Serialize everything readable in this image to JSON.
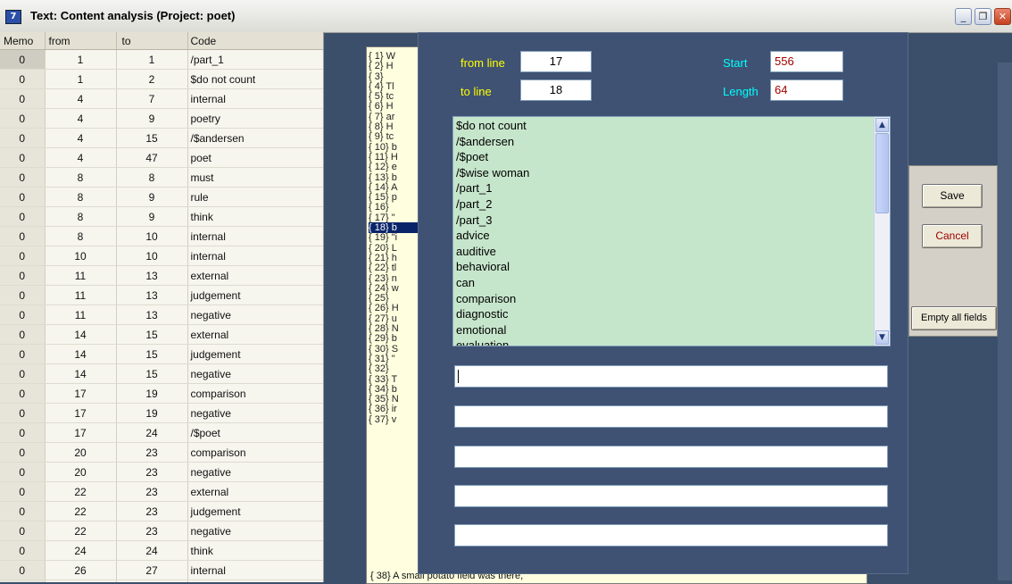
{
  "window": {
    "title": "Text: Content analysis (Project: poet)",
    "icon_label": "7",
    "controls": {
      "minimize": "_",
      "restore": "❐",
      "close": "✕"
    }
  },
  "grid": {
    "headers": {
      "memo": "Memo",
      "from": "from",
      "to": "to",
      "code": "Code"
    },
    "rows": [
      {
        "memo": "0",
        "from": "1",
        "to": "1",
        "code": "/part_1"
      },
      {
        "memo": "0",
        "from": "1",
        "to": "2",
        "code": "$do not count"
      },
      {
        "memo": "0",
        "from": "4",
        "to": "7",
        "code": "internal"
      },
      {
        "memo": "0",
        "from": "4",
        "to": "9",
        "code": "poetry"
      },
      {
        "memo": "0",
        "from": "4",
        "to": "15",
        "code": "/$andersen"
      },
      {
        "memo": "0",
        "from": "4",
        "to": "47",
        "code": "poet"
      },
      {
        "memo": "0",
        "from": "8",
        "to": "8",
        "code": "must"
      },
      {
        "memo": "0",
        "from": "8",
        "to": "9",
        "code": "rule"
      },
      {
        "memo": "0",
        "from": "8",
        "to": "9",
        "code": "think"
      },
      {
        "memo": "0",
        "from": "8",
        "to": "10",
        "code": "internal"
      },
      {
        "memo": "0",
        "from": "10",
        "to": "10",
        "code": "internal"
      },
      {
        "memo": "0",
        "from": "11",
        "to": "13",
        "code": "external"
      },
      {
        "memo": "0",
        "from": "11",
        "to": "13",
        "code": "judgement"
      },
      {
        "memo": "0",
        "from": "11",
        "to": "13",
        "code": "negative"
      },
      {
        "memo": "0",
        "from": "14",
        "to": "15",
        "code": "external"
      },
      {
        "memo": "0",
        "from": "14",
        "to": "15",
        "code": "judgement"
      },
      {
        "memo": "0",
        "from": "14",
        "to": "15",
        "code": "negative"
      },
      {
        "memo": "0",
        "from": "17",
        "to": "19",
        "code": "comparison"
      },
      {
        "memo": "0",
        "from": "17",
        "to": "19",
        "code": "negative"
      },
      {
        "memo": "0",
        "from": "17",
        "to": "24",
        "code": "/$poet"
      },
      {
        "memo": "0",
        "from": "20",
        "to": "23",
        "code": "comparison"
      },
      {
        "memo": "0",
        "from": "20",
        "to": "23",
        "code": "negative"
      },
      {
        "memo": "0",
        "from": "22",
        "to": "23",
        "code": "external"
      },
      {
        "memo": "0",
        "from": "22",
        "to": "23",
        "code": "judgement"
      },
      {
        "memo": "0",
        "from": "22",
        "to": "23",
        "code": "negative"
      },
      {
        "memo": "0",
        "from": "24",
        "to": "24",
        "code": "think"
      },
      {
        "memo": "0",
        "from": "26",
        "to": "27",
        "code": "internal"
      },
      {
        "memo": "0",
        "from": "26",
        "to": "27",
        "code": "think"
      }
    ]
  },
  "text_panel": {
    "lines": [
      "{ 1} W",
      "{ 2} H",
      "{ 3}",
      "{ 4} Tl",
      "{ 5} tc",
      "{ 6} H",
      "{ 7} ar",
      "{ 8} H",
      "{ 9} tc",
      "{ 10} b",
      "{ 11} H",
      "{ 12} e",
      "{ 13} b",
      "{ 14} A",
      "{ 15} p",
      "{ 16}",
      "{ 17} \"",
      "{ 18} b",
      "{ 19} \"i",
      "{ 20} L",
      "{ 21} h",
      "{ 22} tl",
      "{ 23} n",
      "{ 24} w",
      "{ 25}",
      "{ 26} H",
      "{ 27} u",
      "{ 28} N",
      "{ 29} b",
      "{ 30} S",
      "{ 31} \"",
      "{ 32}",
      "{ 33} T",
      "{ 34} b",
      "{ 35} N",
      "{ 36} ir",
      "{ 37} v"
    ],
    "selected_line_index": 17,
    "last_line": "{ 38} A small potato field was there,"
  },
  "dialog": {
    "from_line_label": "from line",
    "from_line_value": "17",
    "to_line_label": "to line",
    "to_line_value": "18",
    "start_label": "Start",
    "start_value": "556",
    "length_label": "Length",
    "length_value": "64",
    "codes": [
      "$do not count",
      "/$andersen",
      "/$poet",
      "/$wise woman",
      "/part_1",
      "/part_2",
      "/part_3",
      "advice",
      "auditive",
      "behavioral",
      "can",
      "comparison",
      "diagnostic",
      "emotional",
      "evaluation"
    ],
    "memo_fields": [
      "",
      "",
      "",
      "",
      ""
    ],
    "scroll_up": "▲",
    "scroll_down": "▼"
  },
  "buttons": {
    "save": "Save",
    "cancel": "Cancel",
    "empty": "Empty all fields"
  },
  "colors": {
    "dialog_bg": "#3f5273",
    "label_yellow": "#ffff00",
    "label_cyan": "#00ffff",
    "listbox_bg": "#c6e6cc",
    "text_panel_bg": "#ffffe0",
    "selection": "#0a246a"
  }
}
